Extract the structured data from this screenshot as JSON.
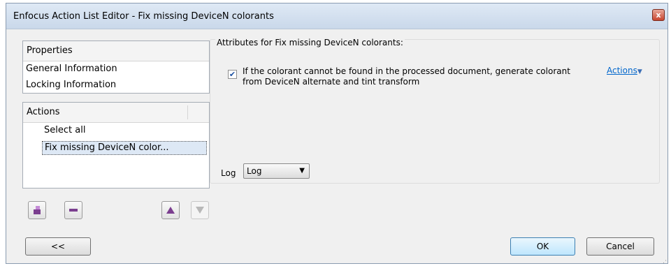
{
  "window": {
    "title": "Enfocus Action List Editor - Fix missing DeviceN colorants",
    "close_glyph": "x"
  },
  "properties": {
    "header": "Properties",
    "items": [
      "General Information",
      "Locking Information"
    ]
  },
  "actions_panel": {
    "header": "Actions",
    "items": [
      "Select all",
      "Fix missing DeviceN color..."
    ]
  },
  "attributes": {
    "title": "Attributes for Fix missing DeviceN colorants:",
    "checkbox_checked": true,
    "checkbox_label": "If the colorant cannot be found in the processed document, generate colorant from DeviceN alternate and tint transform",
    "actions_link": "Actions",
    "log_label": "Log",
    "log_value": "Log"
  },
  "toolbar": {
    "icons": [
      "add-action-icon",
      "remove-action-icon",
      "move-up-icon",
      "move-down-icon"
    ]
  },
  "footer": {
    "back_label": "<<",
    "ok_label": "OK",
    "cancel_label": "Cancel"
  },
  "colors": {
    "accent": "#7b3e8f",
    "link": "#0066cc"
  }
}
